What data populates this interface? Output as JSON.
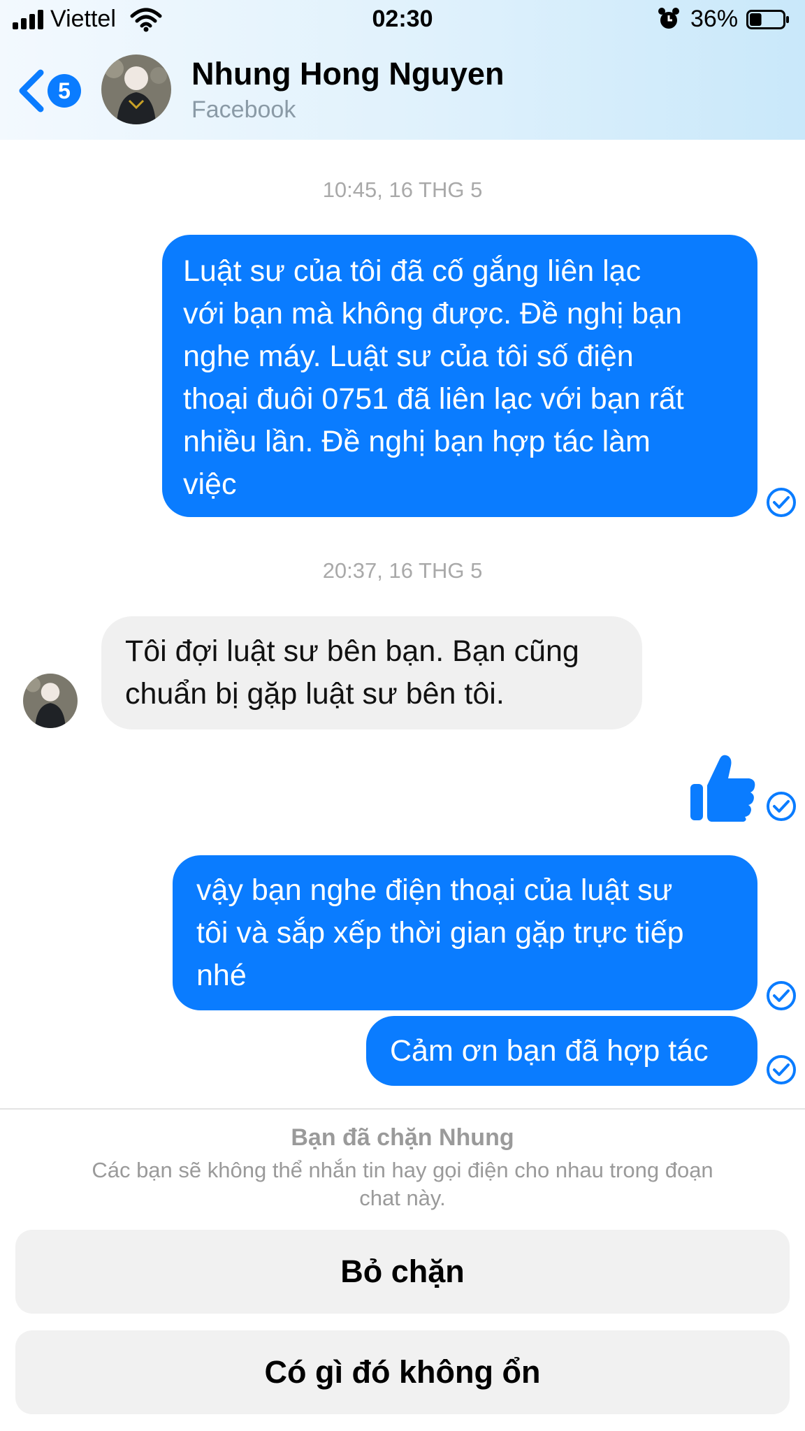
{
  "status_bar": {
    "carrier": "Viettel",
    "time": "02:30",
    "battery_percent": "36%",
    "battery_level": 0.36
  },
  "header": {
    "back_badge": "5",
    "contact_name": "Nhung Hong Nguyen",
    "contact_source": "Facebook"
  },
  "messages": [
    {
      "timestamp": "10:45, 16 THG 5"
    },
    {
      "out_1": [
        "Luật sư của tôi đã cố gắng liên lạc",
        "với bạn mà không được. Đề nghị bạn",
        "nghe máy. Luật sư của tôi số điện",
        "thoại đuôi 0751 đã liên lạc với bạn rất",
        "nhiều lần. Đề nghị bạn hợp tác làm",
        "việc"
      ]
    }
  ],
  "chat": {
    "timestamp_1": "10:45, 16 THG 5",
    "out_1": [
      "Luật sư của tôi đã cố gắng liên lạc",
      "với bạn mà không được. Đề nghị bạn",
      "nghe máy. Luật sư của tôi số điện",
      "thoại đuôi 0751 đã liên lạc với bạn rất",
      "nhiều lần. Đề nghị bạn hợp tác làm",
      "việc"
    ],
    "timestamp_2": "20:37, 16 THG 5",
    "in_1": [
      "Tôi đợi luật sư bên bạn. Bạn cũng",
      "chuẩn bị gặp luật sư bên tôi."
    ],
    "out_2": [
      "vậy bạn nghe điện thoại của luật sư",
      "tôi và sắp xếp thời gian gặp trực tiếp",
      "nhé"
    ],
    "out_3": [
      "Cảm ơn bạn đã hợp tác"
    ]
  },
  "blocked": {
    "title": "Bạn đã chặn Nhung",
    "description": "Các bạn sẽ không thể nhắn tin hay gọi điện cho nhau trong đoạn chat này.",
    "unblock_label": "Bỏ chặn",
    "report_label": "Có gì đó không ổn"
  },
  "colors": {
    "accent": "#0a7cff",
    "incoming_bubble": "#f0f0f0",
    "muted_text": "#9a9a9a"
  }
}
